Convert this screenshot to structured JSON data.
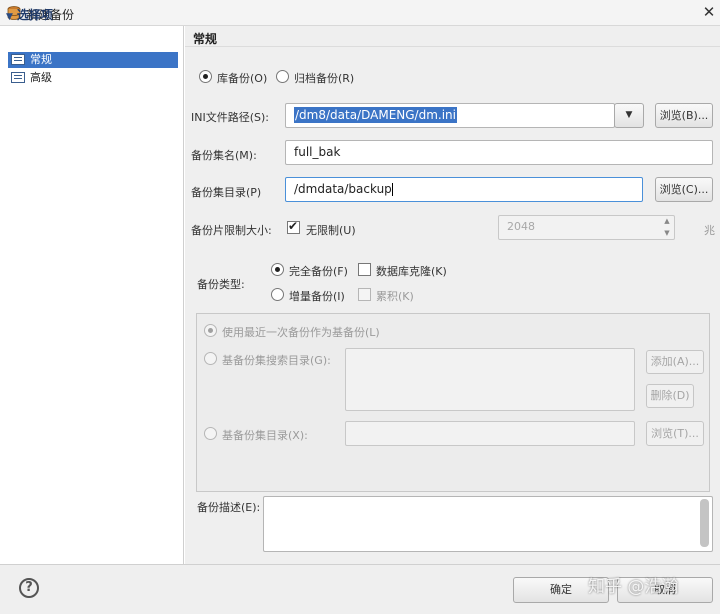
{
  "window": {
    "title": "新建备份",
    "close_glyph": "✕"
  },
  "nav": {
    "header": "选择项",
    "items": [
      {
        "label": "常规",
        "selected": true
      },
      {
        "label": "高级",
        "selected": false
      }
    ]
  },
  "panel": {
    "title": "常规"
  },
  "backup_source": {
    "db_backup_label": "库备份(O)",
    "archive_backup_label": "归档备份(R)",
    "selected": "db_backup"
  },
  "ini_path": {
    "label": "INI文件路径(S):",
    "value": "/dm8/data/DAMENG/dm.ini",
    "browse_label": "浏览(B)..."
  },
  "backup_name": {
    "label": "备份集名(M):",
    "value": "full_bak"
  },
  "backup_dir": {
    "label": "备份集目录(P)",
    "value": "/dmdata/backup",
    "browse_label": "浏览(C)..."
  },
  "piece_limit": {
    "label": "备份片限制大小:",
    "unlimited_label": "无限制(U)",
    "unlimited_checked": true,
    "value": "2048",
    "unit": "兆"
  },
  "backup_type": {
    "label": "备份类型:",
    "full_label": "完全备份(F)",
    "incremental_label": "增量备份(I)",
    "selected": "full",
    "db_clone_label": "数据库克隆(K)",
    "cumulative_label": "累积(K)"
  },
  "base_backup": {
    "use_latest_label": "使用最近一次备份作为基备份(L)",
    "search_dir_label": "基备份集搜索目录(G):",
    "add_label": "添加(A)...",
    "delete_label": "删除(D)",
    "base_dir_label": "基备份集目录(X):",
    "browse_label": "浏览(T)..."
  },
  "description": {
    "label": "备份描述(E):",
    "value": ""
  },
  "footer": {
    "help_glyph": "?",
    "ok_label": "确定",
    "cancel_label": "取消",
    "watermark": "知乎 @浩瀚"
  }
}
